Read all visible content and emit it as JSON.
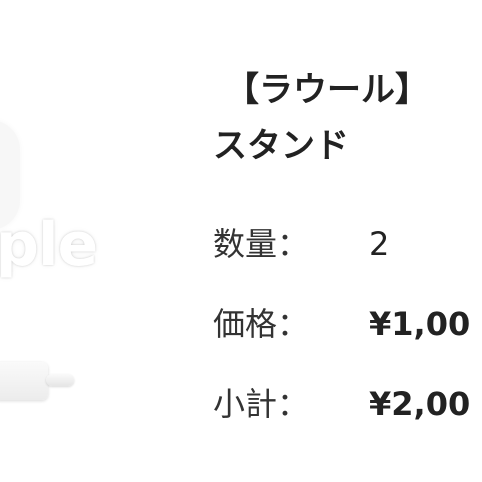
{
  "product": {
    "title_line1": "【ラウール】",
    "title_line2": "スタンド",
    "watermark": "ple"
  },
  "quantity": {
    "label": "数量：",
    "value": "2"
  },
  "price": {
    "label": "価格：",
    "value": "¥1,00"
  },
  "subtotal": {
    "label": "小計：",
    "value": "¥2,00"
  }
}
